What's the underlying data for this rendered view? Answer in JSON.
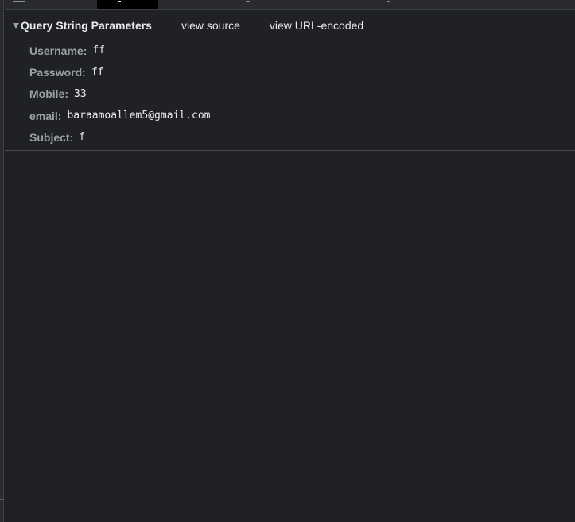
{
  "section": {
    "title": "Query String Parameters",
    "toggle_icon": "triangle-down-icon",
    "links": {
      "view_source": "view source",
      "view_url_encoded": "view URL-encoded"
    }
  },
  "params": [
    {
      "key": "Username:",
      "value": "ff"
    },
    {
      "key": "Password:",
      "value": "ff"
    },
    {
      "key": "Mobile:",
      "value": "33"
    },
    {
      "key": "email:",
      "value": "baraamoallem5@gmail.com"
    },
    {
      "key": "Subject:",
      "value": "f"
    }
  ],
  "colors": {
    "background": "#202124",
    "text_primary": "#e8eaed",
    "text_key": "#9aa0a6",
    "active_tab": "#000000",
    "divider": "#4a4c50"
  }
}
